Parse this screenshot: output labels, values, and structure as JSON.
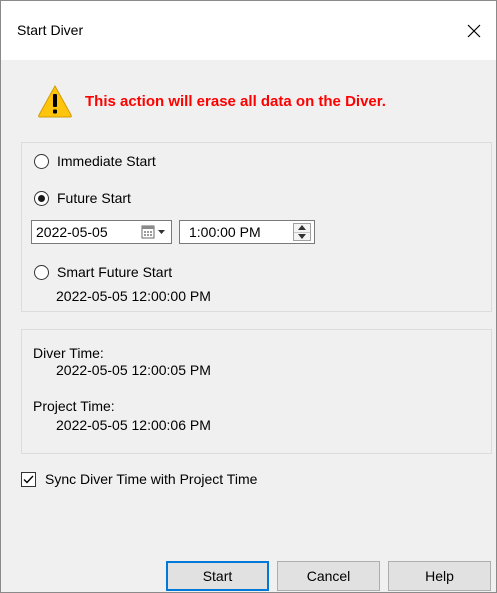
{
  "window": {
    "title": "Start Diver"
  },
  "warning": {
    "text": "This action will erase all data on the Diver.",
    "color": "#ff0000",
    "icon": "warning-triangle-icon"
  },
  "start_options": {
    "immediate_label": "Immediate Start",
    "future_label": "Future Start",
    "selected": "future",
    "date_value": "2022-05-05",
    "time_value": "1:00:00 PM",
    "smart_label": "Smart Future Start",
    "smart_datetime": "2022-05-05 12:00:00 PM"
  },
  "times": {
    "diver_label": "Diver Time:",
    "diver_value": "2022-05-05 12:00:05 PM",
    "project_label": "Project Time:",
    "project_value": "2022-05-05 12:00:06 PM"
  },
  "sync": {
    "label": "Sync Diver Time with Project Time",
    "checked": true
  },
  "buttons": {
    "start": "Start",
    "cancel": "Cancel",
    "help": "Help"
  },
  "colors": {
    "accent": "#0078d7",
    "dialog_bg": "#f0f0f0"
  }
}
